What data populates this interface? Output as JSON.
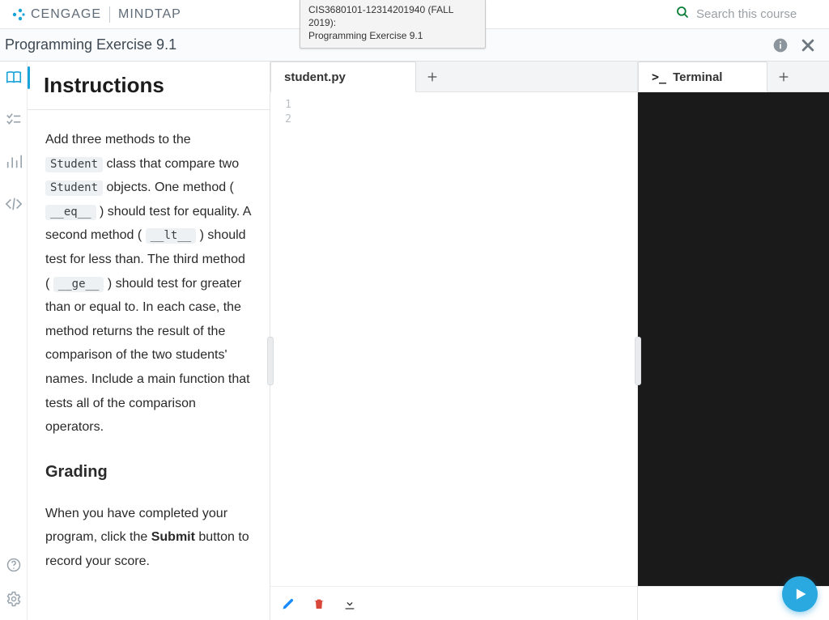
{
  "brand": {
    "left": "CENGAGE",
    "right": "MINDTAP"
  },
  "tooltip": {
    "line1": "CIS3680101-12314201940 (FALL 2019):",
    "line2": "Programming Exercise 9.1"
  },
  "search": {
    "placeholder": "Search this course"
  },
  "subheader": {
    "title": "Programming Exercise 9.1"
  },
  "instructions": {
    "heading": "Instructions",
    "p1a": "Add three methods to the ",
    "code1": "Student",
    "p1b": " class that compare two ",
    "code2": "Student",
    "p1c": " objects. One method ( ",
    "code3": "__eq__",
    "p1d": " ) should test for equality. A second method ( ",
    "code4": "__lt__",
    "p1e": " ) should test for less than. The third method ( ",
    "code5": "__ge__",
    "p1f": " ) should test for greater than or equal to. In each case, the method returns the result of the comparison of the two students' names. Include a main function that tests all of the comparison operators.",
    "h2": "Grading",
    "p2a": "When you have completed your program, click the ",
    "p2b": "Submit",
    "p2c": " button to record your score."
  },
  "editor": {
    "tab_label": "student.py",
    "line_numbers": [
      "1",
      "2"
    ]
  },
  "terminal": {
    "prompt": ">_",
    "label": "Terminal"
  }
}
